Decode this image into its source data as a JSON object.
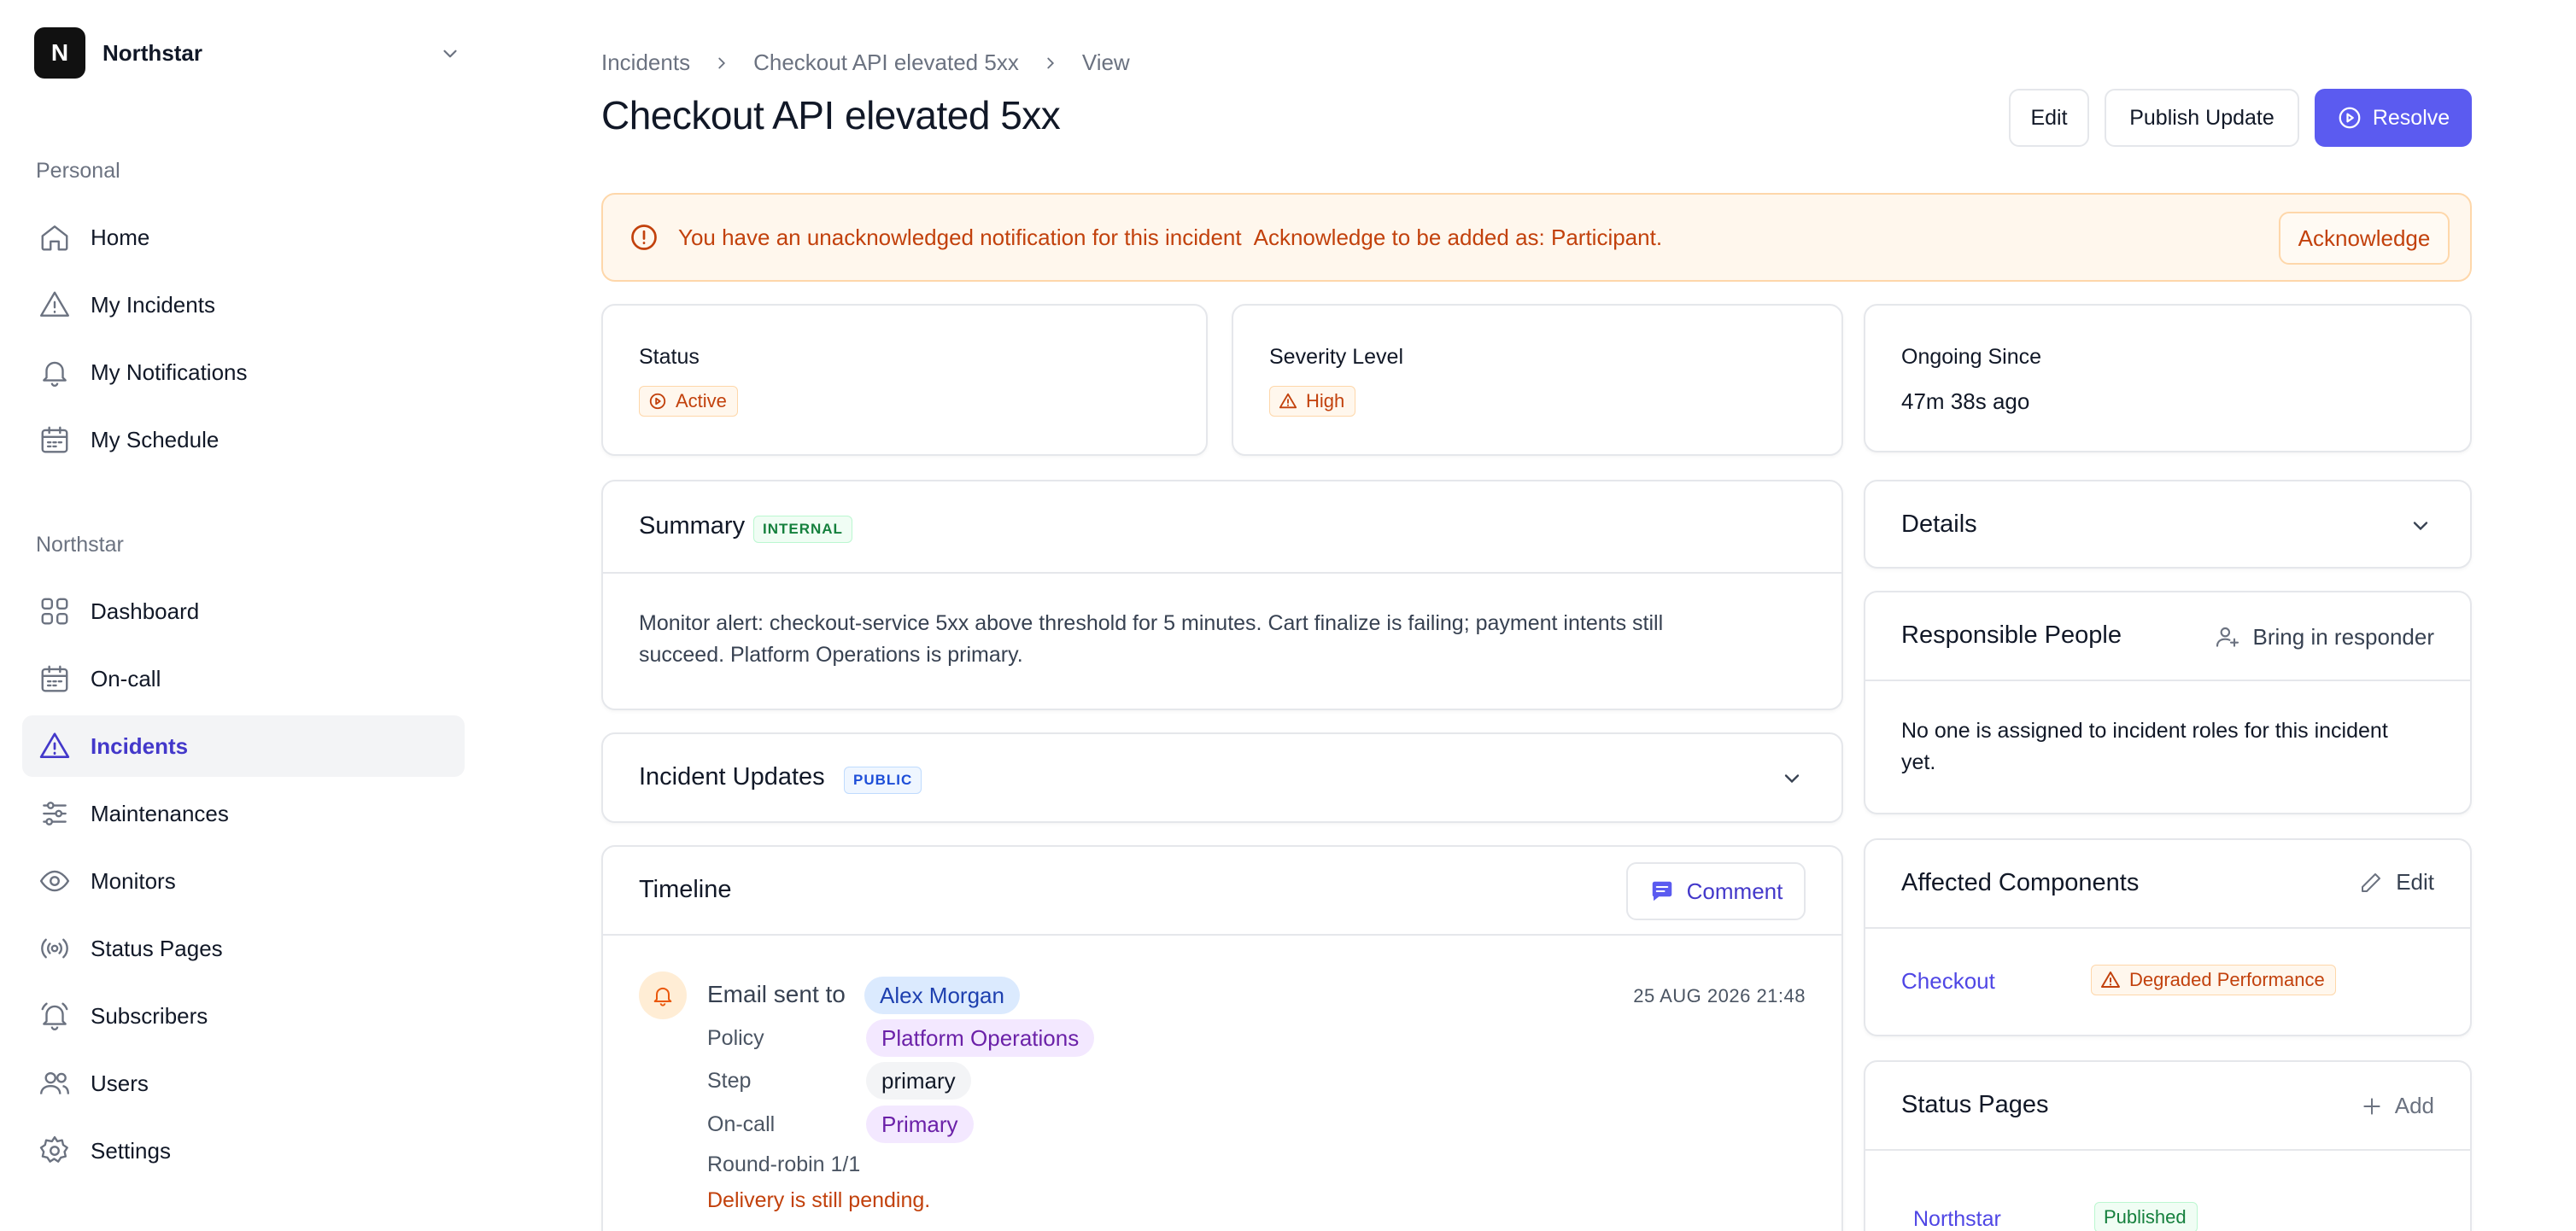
{
  "org": {
    "initial": "N",
    "name": "Northstar"
  },
  "sidebar": {
    "personal_label": "Personal",
    "personal_items": [
      {
        "label": "Home",
        "icon": "home-icon"
      },
      {
        "label": "My Incidents",
        "icon": "warning-icon"
      },
      {
        "label": "My Notifications",
        "icon": "bell-icon"
      },
      {
        "label": "My Schedule",
        "icon": "calendar-icon"
      }
    ],
    "org_label": "Northstar",
    "org_items": [
      {
        "label": "Dashboard",
        "icon": "grid-icon"
      },
      {
        "label": "On-call",
        "icon": "calendar-icon"
      },
      {
        "label": "Incidents",
        "icon": "warning-icon",
        "active": true
      },
      {
        "label": "Maintenances",
        "icon": "sliders-icon"
      },
      {
        "label": "Monitors",
        "icon": "eye-icon"
      },
      {
        "label": "Status Pages",
        "icon": "broadcast-icon"
      },
      {
        "label": "Subscribers",
        "icon": "bell-icon"
      },
      {
        "label": "Users",
        "icon": "users-icon"
      },
      {
        "label": "Settings",
        "icon": "gear-icon"
      }
    ]
  },
  "breadcrumb": [
    "Incidents",
    "Checkout API elevated 5xx",
    "View"
  ],
  "page_title": "Checkout API elevated 5xx",
  "actions": {
    "edit": "Edit",
    "publish": "Publish Update",
    "resolve": "Resolve"
  },
  "alert": {
    "strong": "You have an unacknowledged notification for this incident",
    "rest": "Acknowledge to be added as: Participant.",
    "button": "Acknowledge"
  },
  "status": {
    "label": "Status",
    "value": "Active"
  },
  "severity": {
    "label": "Severity Level",
    "value": "High"
  },
  "ongoing": {
    "label": "Ongoing Since",
    "value": "47m 38s ago"
  },
  "summary": {
    "title": "Summary",
    "tag": "INTERNAL",
    "line1": "Monitor alert: checkout-service 5xx above threshold for 5 minutes. Cart finalize is failing; payment intents still",
    "line2": "succeed. Platform Operations is primary."
  },
  "incident_updates": {
    "title": "Incident Updates",
    "tag": "PUBLIC"
  },
  "timeline": {
    "title": "Timeline",
    "comment": "Comment",
    "entry": {
      "prefix": "Email sent to",
      "recipient": "Alex Morgan",
      "time": "25 AUG 2026 21:48",
      "policy_label": "Policy",
      "policy": "Platform Operations",
      "step_label": "Step",
      "step": "primary",
      "oncall_label": "On-call",
      "oncall": "Primary",
      "round_robin": "Round-robin 1/1",
      "delivery": "Delivery is still pending."
    }
  },
  "details": {
    "title": "Details"
  },
  "responsible": {
    "title": "Responsible People",
    "action": "Bring in responder",
    "line1": "No one is assigned to incident roles for this incident",
    "line2": "yet."
  },
  "affected": {
    "title": "Affected Components",
    "action": "Edit",
    "component": "Checkout",
    "state": "Degraded Performance"
  },
  "status_pages": {
    "title": "Status Pages",
    "action": "Add",
    "page": "Northstar",
    "state": "Published"
  },
  "colors": {
    "accent": "#5b5bf0",
    "warning": "#c2410c",
    "active_nav": "#4338ca"
  }
}
